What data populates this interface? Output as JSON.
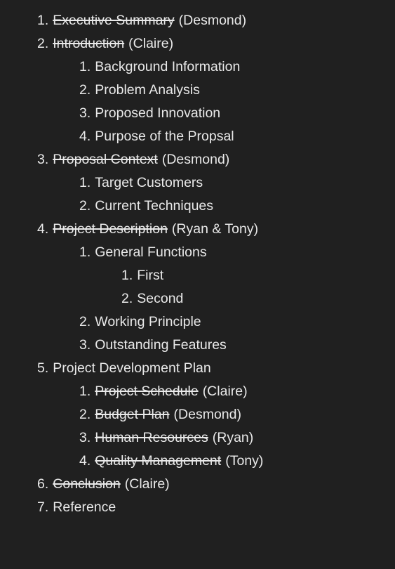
{
  "outline": [
    {
      "level": 1,
      "number": "1.",
      "title": "Executive Summary",
      "struck": true,
      "owner": "(Desmond)"
    },
    {
      "level": 1,
      "number": "2.",
      "title": "Introduction",
      "struck": true,
      "owner": "(Claire)"
    },
    {
      "level": 2,
      "number": "1.",
      "title": "Background Information",
      "struck": false,
      "owner": ""
    },
    {
      "level": 2,
      "number": "2.",
      "title": "Problem Analysis",
      "struck": false,
      "owner": ""
    },
    {
      "level": 2,
      "number": "3.",
      "title": "Proposed Innovation",
      "struck": false,
      "owner": ""
    },
    {
      "level": 2,
      "number": "4.",
      "title": "Purpose of the Propsal",
      "struck": false,
      "owner": ""
    },
    {
      "level": 1,
      "number": "3.",
      "title": "Proposal Context",
      "struck": true,
      "owner": "(Desmond)"
    },
    {
      "level": 2,
      "number": "1.",
      "title": "Target Customers",
      "struck": false,
      "owner": ""
    },
    {
      "level": 2,
      "number": "2.",
      "title": "Current Techniques",
      "struck": false,
      "owner": ""
    },
    {
      "level": 1,
      "number": "4.",
      "title": "Project Description",
      "struck": true,
      "owner": "(Ryan & Tony)"
    },
    {
      "level": 2,
      "number": "1.",
      "title": "General Functions",
      "struck": false,
      "owner": ""
    },
    {
      "level": 3,
      "number": "1.",
      "title": "First",
      "struck": false,
      "owner": ""
    },
    {
      "level": 3,
      "number": "2.",
      "title": "Second",
      "struck": false,
      "owner": ""
    },
    {
      "level": 2,
      "number": "2.",
      "title": "Working Principle",
      "struck": false,
      "owner": ""
    },
    {
      "level": 2,
      "number": "3.",
      "title": "Outstanding Features",
      "struck": false,
      "owner": ""
    },
    {
      "level": 1,
      "number": "5.",
      "title": "Project Development Plan",
      "struck": false,
      "owner": ""
    },
    {
      "level": 2,
      "number": "1.",
      "title": "Project Schedule",
      "struck": true,
      "owner": "(Claire)"
    },
    {
      "level": 2,
      "number": "2.",
      "title": "Budget Plan",
      "struck": true,
      "owner": "(Desmond)"
    },
    {
      "level": 2,
      "number": "3.",
      "title": "Human Resources",
      "struck": true,
      "owner": "(Ryan)"
    },
    {
      "level": 2,
      "number": "4.",
      "title": "Quality Management",
      "struck": true,
      "owner": "(Tony)"
    },
    {
      "level": 1,
      "number": "6.",
      "title": "Conclusion",
      "struck": true,
      "owner": "(Claire)"
    },
    {
      "level": 1,
      "number": "7.",
      "title": "Reference",
      "struck": false,
      "owner": ""
    }
  ]
}
